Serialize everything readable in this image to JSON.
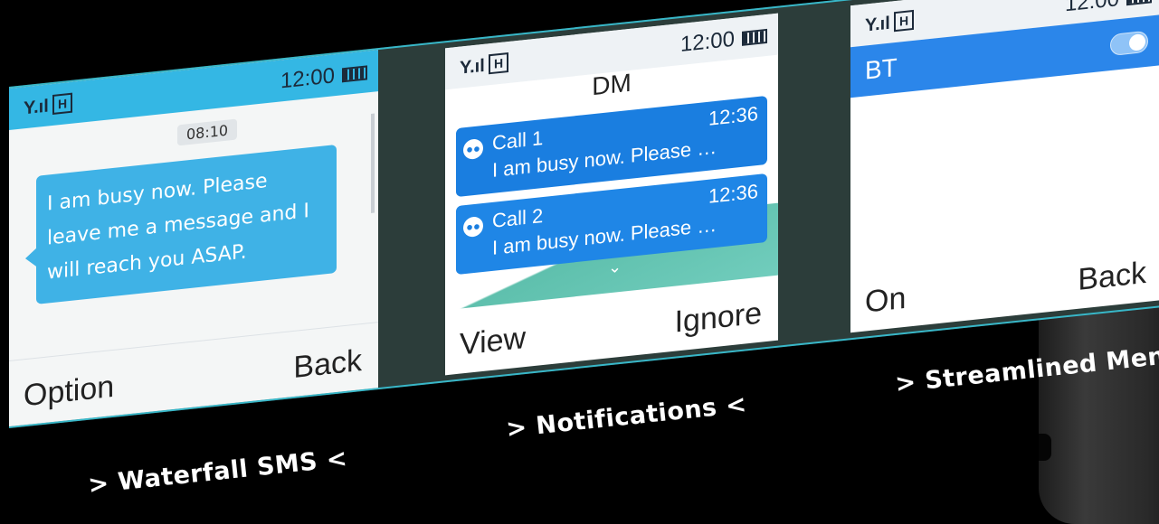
{
  "screens": {
    "sms": {
      "status": {
        "time": "12:00"
      },
      "timestamp": "08:10",
      "message": "I am busy now. Please leave me a message and I will reach you ASAP.",
      "softkeys": {
        "left": "Option",
        "right": "Back"
      },
      "caption": "> Waterfall SMS <"
    },
    "notifications": {
      "status": {
        "time": "12:00"
      },
      "title": "DM",
      "items": [
        {
          "name": "Call 1",
          "time": "12:36",
          "message": "I am busy now. Please …"
        },
        {
          "name": "Call 2",
          "time": "12:36",
          "message": "I am busy now. Please …"
        }
      ],
      "softkeys": {
        "left": "View",
        "right": "Ignore"
      },
      "caption": "> Notifications <"
    },
    "menu": {
      "status": {
        "time": "12:00"
      },
      "item": {
        "label": "BT",
        "toggle_on": true
      },
      "softkeys": {
        "left": "On",
        "right": "Back"
      },
      "caption": "> Streamlined Menu <"
    }
  },
  "icons": {
    "signal": "signal-icon",
    "h_network": "h-network-icon",
    "battery": "battery-icon",
    "contact": "contact-icon",
    "chevron": "chevron-down-icon"
  },
  "colors": {
    "accent_cyan": "#34b7e4",
    "bubble": "#3fb2e6",
    "card_blue": "#1a7ee0",
    "frame_border": "#38b7c8",
    "frame_bg": "#2c3d3a"
  }
}
